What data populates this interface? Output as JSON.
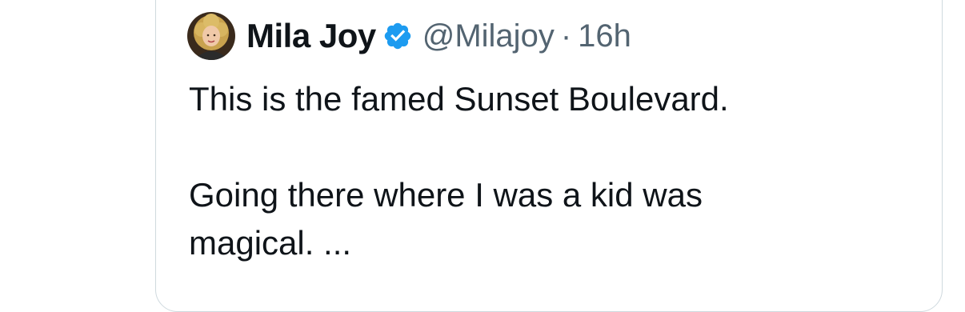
{
  "colors": {
    "primary_text": "#0f1419",
    "secondary_text": "#536471",
    "verified_blue": "#1d9bf0",
    "border": "#cfd9de"
  },
  "tweet": {
    "author": {
      "display_name": "Mila Joy",
      "handle": "@Milajoy",
      "verified": true,
      "avatar_icon": "user-avatar-photo"
    },
    "separator": "·",
    "timestamp": "16h",
    "text_line_1": "This is the famed Sunset Boulevard.",
    "text_line_2": "Going there where I was a kid was",
    "text_line_3": "magical. ..."
  }
}
